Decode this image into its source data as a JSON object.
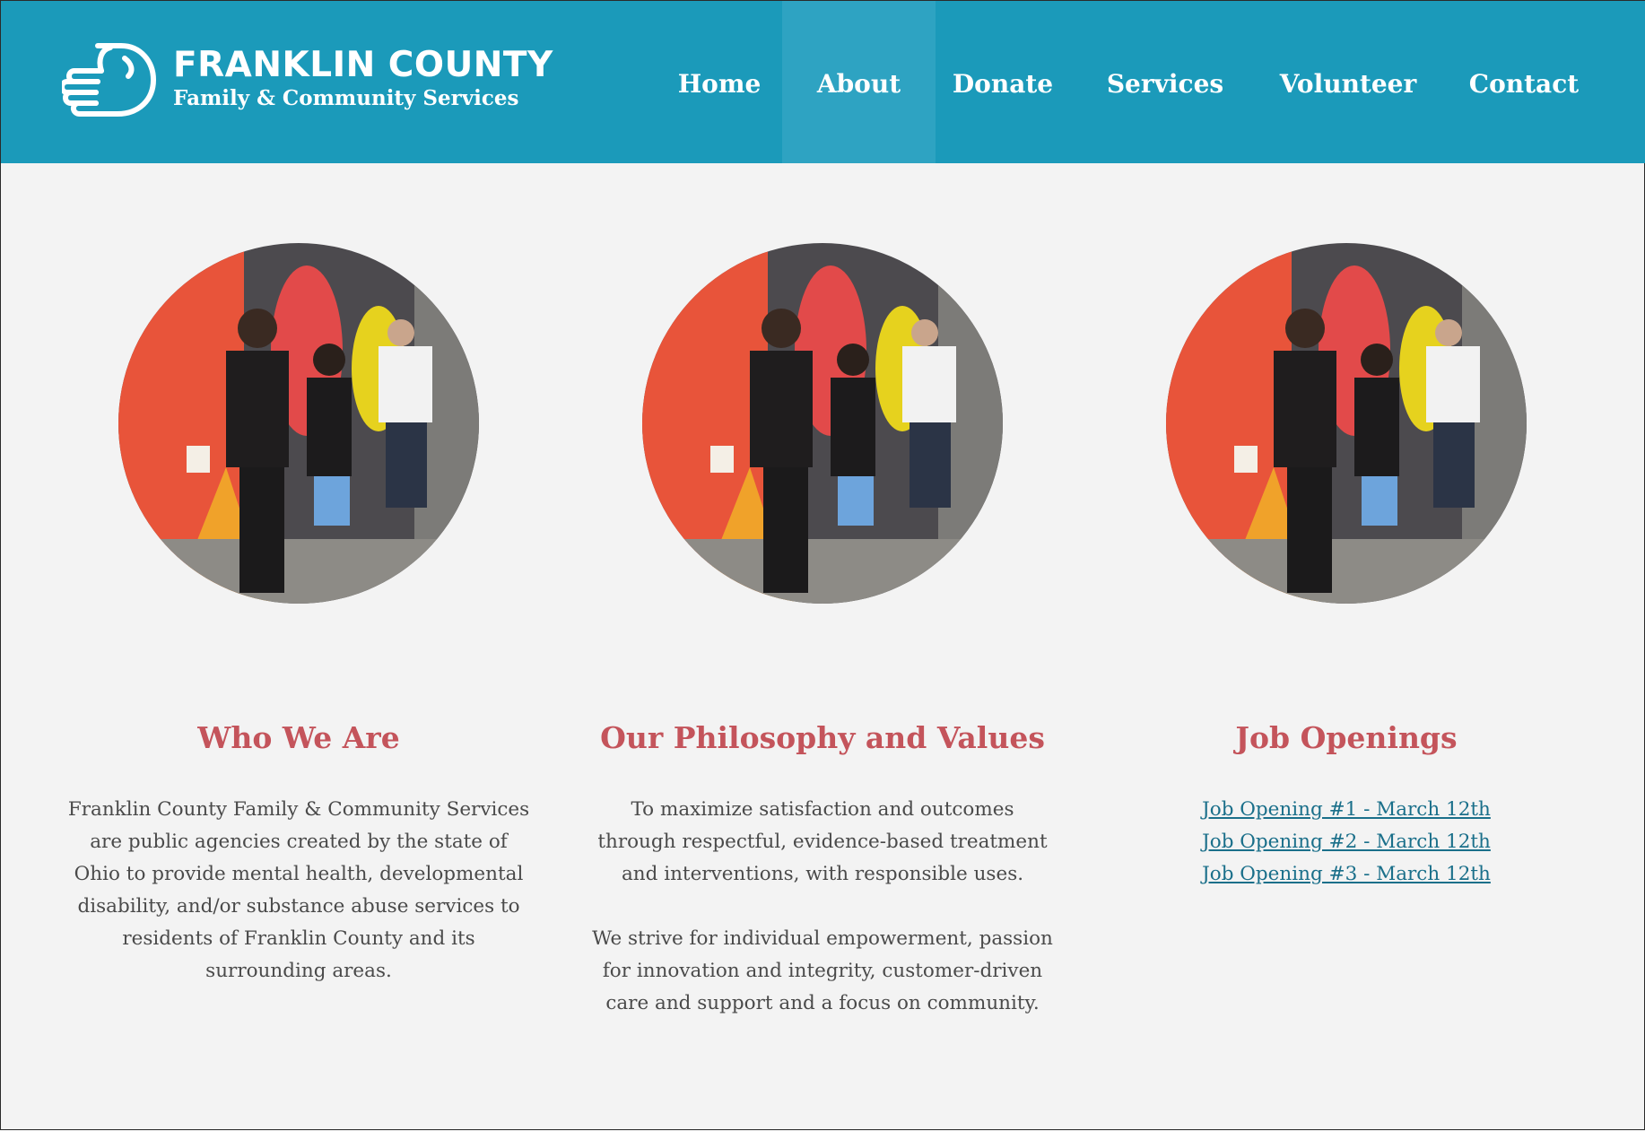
{
  "brand": {
    "title": "FRANKLIN COUNTY",
    "subtitle": "Family & Community Services",
    "icon": "hand-logo-icon"
  },
  "colors": {
    "header": "#1b9aba",
    "nav_active": "#2ea3c2",
    "heading": "#c4545b",
    "link": "#1a6f8a",
    "body_text": "#4a4a4a",
    "background": "#f3f3f3"
  },
  "nav": {
    "items": [
      {
        "label": "Home",
        "active": false
      },
      {
        "label": "About",
        "active": true
      },
      {
        "label": "Donate",
        "active": false
      },
      {
        "label": "Services",
        "active": false
      },
      {
        "label": "Volunteer",
        "active": false
      },
      {
        "label": "Contact",
        "active": false
      }
    ]
  },
  "sections": [
    {
      "title": "Who We Are",
      "image": "mural-painting-photo",
      "paragraphs": [
        "Franklin County Family & Community Services are public agencies created by the state of Ohio to provide mental health, developmental disability, and/or substance abuse services to residents of Franklin County and its surrounding areas."
      ]
    },
    {
      "title": "Our Philosophy and Values",
      "image": "mural-painting-photo",
      "paragraphs": [
        "To maximize satisfaction and outcomes through respectful, evidence-based treatment and interventions, with responsible uses.",
        "We strive for individual empowerment, passion for innovation and integrity, customer-driven care and support and a focus on community."
      ]
    },
    {
      "title": "Job Openings",
      "image": "mural-painting-photo",
      "links": [
        "Job Opening #1 - March 12th",
        "Job Opening #2 - March 12th",
        "Job Opening #3 - March 12th"
      ]
    }
  ]
}
